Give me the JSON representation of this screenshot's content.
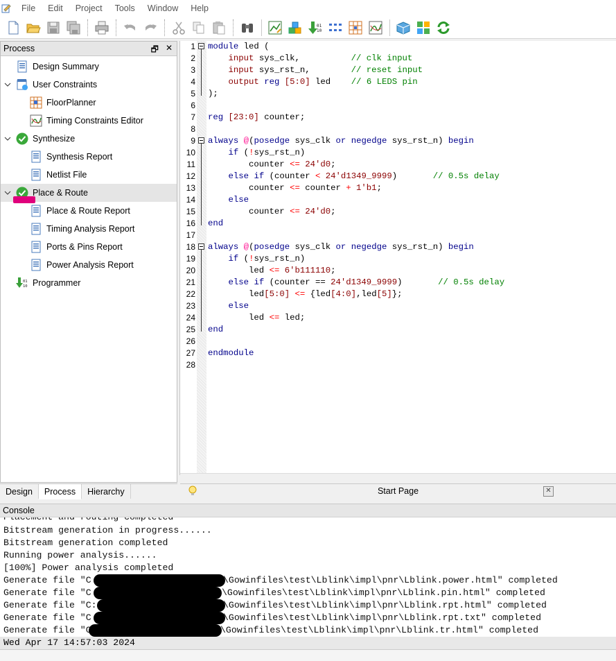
{
  "menu": [
    "File",
    "Edit",
    "Project",
    "Tools",
    "Window",
    "Help"
  ],
  "toolbar_icons": [
    "new-file-icon",
    "open-folder-icon",
    "save-icon",
    "save-all-icon",
    "print-icon",
    "undo-icon",
    "redo-icon",
    "cut-icon",
    "copy-icon",
    "paste-icon",
    "find-icon",
    "synthesize-tool-icon",
    "ip-core-icon",
    "programmer-icon",
    "bitstream-icon",
    "register-icon",
    "floorplanner-icon",
    "timing-icon",
    "package-icon",
    "layout-icon",
    "refresh-icon"
  ],
  "process_panel": {
    "title": "Process",
    "items": [
      {
        "label": "Design Summary"
      },
      {
        "label": "User Constraints"
      },
      {
        "label": "FloorPlanner"
      },
      {
        "label": "Timing Constraints Editor"
      },
      {
        "label": "Synthesize"
      },
      {
        "label": "Synthesis Report"
      },
      {
        "label": "Netlist File"
      },
      {
        "label": "Place & Route"
      },
      {
        "label": "Place & Route Report"
      },
      {
        "label": "Timing Analysis Report"
      },
      {
        "label": "Ports & Pins Report"
      },
      {
        "label": "Power Analysis Report"
      },
      {
        "label": "Programmer"
      }
    ]
  },
  "left_tabs": [
    "Design",
    "Process",
    "Hierarchy"
  ],
  "editor": {
    "tab_title": "Start Page",
    "lines": [
      "module led (",
      "    input sys_clk,          // clk input",
      "    input sys_rst_n,        // reset input",
      "    output reg [5:0] led    // 6 LEDS pin",
      ");",
      "",
      "reg [23:0] counter;",
      "",
      "always @(posedge sys_clk or negedge sys_rst_n) begin",
      "    if (!sys_rst_n)",
      "        counter <= 24'd0;",
      "    else if (counter < 24'd1349_9999)       // 0.5s delay",
      "        counter <= counter + 1'b1;",
      "    else",
      "        counter <= 24'd0;",
      "end",
      "",
      "always @(posedge sys_clk or negedge sys_rst_n) begin",
      "    if (!sys_rst_n)",
      "        led <= 6'b111110;",
      "    else if (counter == 24'd1349_9999)       // 0.5s delay",
      "        led[5:0] <= {led[4:0],led[5]};",
      "    else",
      "        led <= led;",
      "end",
      "",
      "endmodule",
      ""
    ]
  },
  "console": {
    "title": "Console",
    "lines": [
      "Placement and routing completed",
      "Bitstream generation in progress......",
      "Bitstream generation completed",
      "Running power analysis......",
      "[100%] Power analysis completed",
      "Generate file \"C",
      "Generate file \"C",
      "Generate file \"C:",
      "Generate file \"C",
      "Generate file \"C"
    ],
    "paths": [
      "\\Gowinfiles\\test\\Lblink\\impl\\pnr\\Lblink.power.html\" completed",
      "\\Gowinfiles\\test\\Lblink\\impl\\pnr\\Lblink.pin.html\" completed",
      "\\Gowinfiles\\test\\Lblink\\impl\\pnr\\Lblink.rpt.html\" completed",
      "\\Gowinfiles\\test\\Lblink\\impl\\pnr\\Lblink.rpt.txt\" completed",
      "\\Gowinfiles\\test\\Lblink\\impl\\pnr\\Lblink.tr.html\" completed"
    ],
    "timestamp": "Wed Apr 17 14:57:03 2024"
  },
  "colors": {
    "keyword": "#00008b",
    "comment": "#008000",
    "number": "#ff1493",
    "highlight": "#e0007c"
  }
}
